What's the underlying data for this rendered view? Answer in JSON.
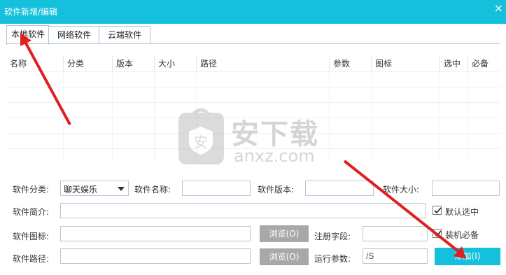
{
  "window": {
    "title": "软件新增/编辑",
    "close_glyph": "×"
  },
  "tabs": [
    {
      "label": "本地软件",
      "active": true
    },
    {
      "label": "网络软件",
      "active": false
    },
    {
      "label": "云端软件",
      "active": false
    }
  ],
  "table": {
    "columns": [
      "名称",
      "分类",
      "版本",
      "大小",
      "路径",
      "参数",
      "图标",
      "选中",
      "必备"
    ],
    "rows": []
  },
  "form": {
    "category_label": "软件分类:",
    "category_value": "聊天娱乐",
    "name_label": "软件名称:",
    "name_value": "",
    "version_label": "软件版本:",
    "version_value": "",
    "size_label": "软件大小:",
    "size_value": "",
    "intro_label": "软件简介:",
    "intro_value": "",
    "icon_label": "软件图标:",
    "icon_value": "",
    "path_label": "软件路径:",
    "path_value": "",
    "browse_icon_label": "浏览(O)",
    "browse_path_label": "浏览(O)",
    "reg_label": "注册字段:",
    "reg_value": "",
    "param_label": "运行参数:",
    "param_value": "/S",
    "default_selected_label": "默认选中",
    "default_selected_checked": true,
    "must_install_label": "装机必备",
    "must_install_checked": true,
    "add_button_label": "添加(I)"
  },
  "watermark": {
    "text": "安下载",
    "subtext": "anxz.com"
  },
  "colors": {
    "accent": "#15c0dc",
    "arrow": "#e02020",
    "button_gray": "#a8a8a8"
  }
}
